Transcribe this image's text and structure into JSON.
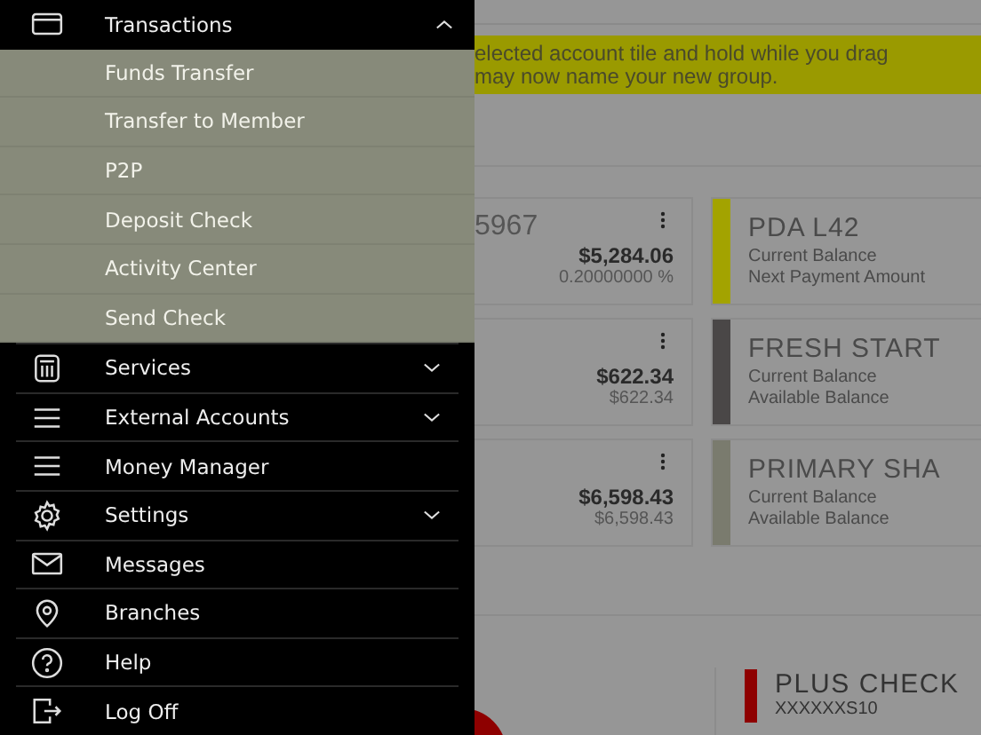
{
  "menu": [
    {
      "kind": "header",
      "label": "Transactions",
      "expanded": true
    },
    {
      "kind": "sub",
      "label": "Funds Transfer"
    },
    {
      "kind": "sub",
      "label": "Transfer to Member"
    },
    {
      "kind": "sub",
      "label": "P2P"
    },
    {
      "kind": "sub",
      "label": "Deposit Check"
    },
    {
      "kind": "sub",
      "label": "Activity Center"
    },
    {
      "kind": "sub",
      "label": "Send Check"
    },
    {
      "kind": "item",
      "label": "Services",
      "expanded": false
    },
    {
      "kind": "item",
      "label": "External Accounts",
      "expanded": false
    },
    {
      "kind": "item",
      "label": "Money Manager"
    },
    {
      "kind": "item",
      "label": "Settings",
      "expanded": false
    },
    {
      "kind": "item",
      "label": "Messages"
    },
    {
      "kind": "item",
      "label": "Branches"
    },
    {
      "kind": "item",
      "label": "Help"
    },
    {
      "kind": "item",
      "label": "Log Off"
    }
  ],
  "banner": {
    "lines": [
      "elected account tile and hold while you drag",
      "may now name your new group."
    ]
  },
  "accounts": [
    {
      "left": {
        "name": "5967",
        "amount": "$5,284.06",
        "sub": "0.20000000 %"
      },
      "right": {
        "name": "PDA L42",
        "color": "#a3a300",
        "labels": [
          "Current Balance",
          "Next Payment Amount"
        ]
      }
    },
    {
      "left": {
        "amount": "$622.34",
        "sub": "$622.34"
      },
      "right": {
        "name": "FRESH START",
        "color": "#4a4747",
        "labels": [
          "Current Balance",
          "Available Balance"
        ]
      }
    },
    {
      "left": {
        "amount": "$6,598.43",
        "sub": "$6,598.43"
      },
      "right": {
        "name": "PRIMARY SHA",
        "color": "#7a7b6e",
        "labels": [
          "Current Balance",
          "Available Balance"
        ]
      }
    }
  ],
  "bottom_account": {
    "name": "PLUS CHECK",
    "number": "XXXXXXS10",
    "color": "#8e0000"
  }
}
